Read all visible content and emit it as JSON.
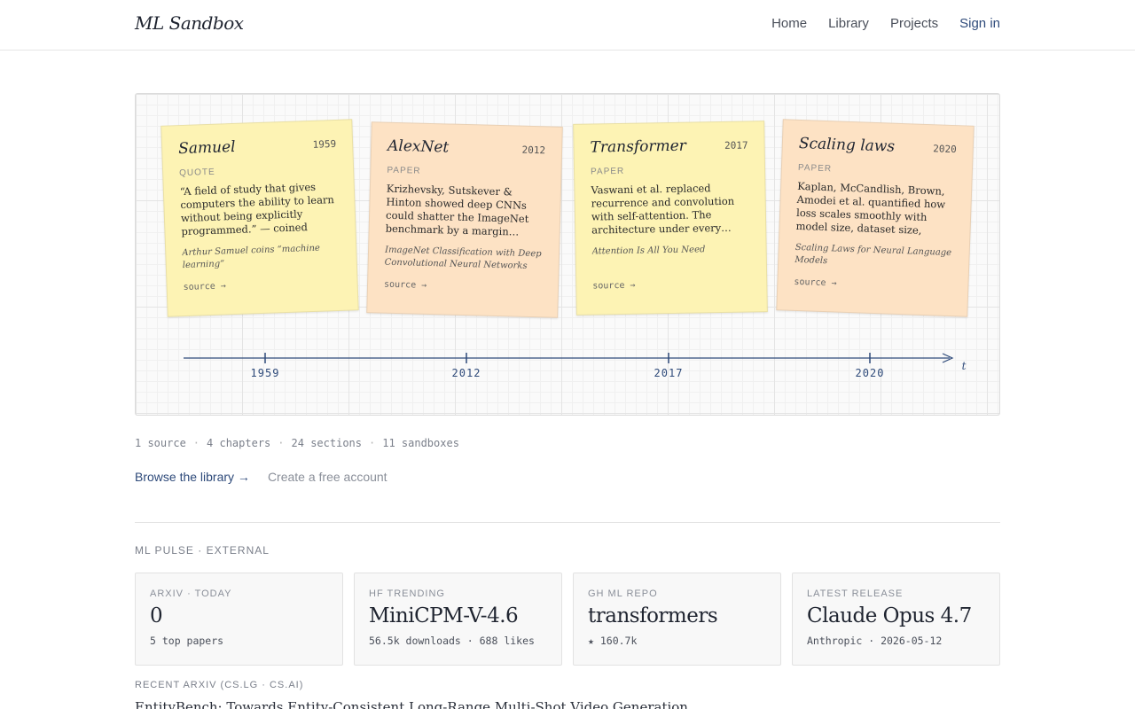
{
  "header": {
    "brand": "ML Sandbox",
    "nav": [
      "Home",
      "Library",
      "Projects"
    ],
    "signin": "Sign in"
  },
  "timeline": {
    "cards": [
      {
        "title": "Samuel",
        "year": "1959",
        "kind": "QUOTE",
        "body": "“A field of study that gives computers the ability to learn without being explicitly programmed.” — coined whil…",
        "source": "Arthur Samuel coins “machine learning”",
        "link": "source →",
        "color": "yellow"
      },
      {
        "title": "AlexNet",
        "year": "2012",
        "kind": "PAPER",
        "body": "Krizhevsky, Sutskever & Hinton showed deep CNNs could shatter the ImageNet benchmark by a margin…",
        "source": "ImageNet Classification with Deep Convolutional Neural Networks",
        "link": "source →",
        "color": "peach"
      },
      {
        "title": "Transformer",
        "year": "2017",
        "kind": "PAPER",
        "body": "Vaswani et al. replaced recurrence and convolution with self-attention. The architecture under every…",
        "source": "Attention Is All You Need",
        "link": "source →",
        "color": "yellow"
      },
      {
        "title": "Scaling laws",
        "year": "2020",
        "kind": "PAPER",
        "body": "Kaplan, McCandlish, Brown, Amodei et al. quantified how loss scales smoothly with model size, dataset size, and…",
        "source": "Scaling Laws for Neural Language Models",
        "link": "source →",
        "color": "peach"
      }
    ],
    "axis_ticks": [
      "1959",
      "2012",
      "2017",
      "2020"
    ],
    "axis_label": "t"
  },
  "stats": {
    "sources": "1 source",
    "chapters": "4 chapters",
    "sections": "24 sections",
    "sandboxes": "11 sandboxes"
  },
  "cta": {
    "browse": "Browse the library →",
    "create": "Create a free account"
  },
  "pulse": {
    "label": "ML PULSE · EXTERNAL",
    "cards": [
      {
        "kicker": "ARXIV · TODAY",
        "value": "0",
        "meta": "5 top papers"
      },
      {
        "kicker": "HF TRENDING",
        "value": "MiniCPM-V-4.6",
        "meta": "56.5k downloads · 688 likes"
      },
      {
        "kicker": "GH ML REPO",
        "value": "transformers",
        "meta": "★ 160.7k"
      },
      {
        "kicker": "LATEST RELEASE",
        "value": "Claude Opus 4.7",
        "meta": "Anthropic · 2026-05-12"
      }
    ]
  },
  "recent": {
    "label": "RECENT ARXIV (CS.LG · CS.AI)",
    "first_title": "EntityBench: Towards Entity-Consistent Long-Range Multi-Shot Video Generation"
  },
  "colors": {
    "accent": "#2e4a7a",
    "card_yellow": "#fdf3b4",
    "card_peach": "#fde2c4",
    "axis": "#2e4a7a"
  }
}
